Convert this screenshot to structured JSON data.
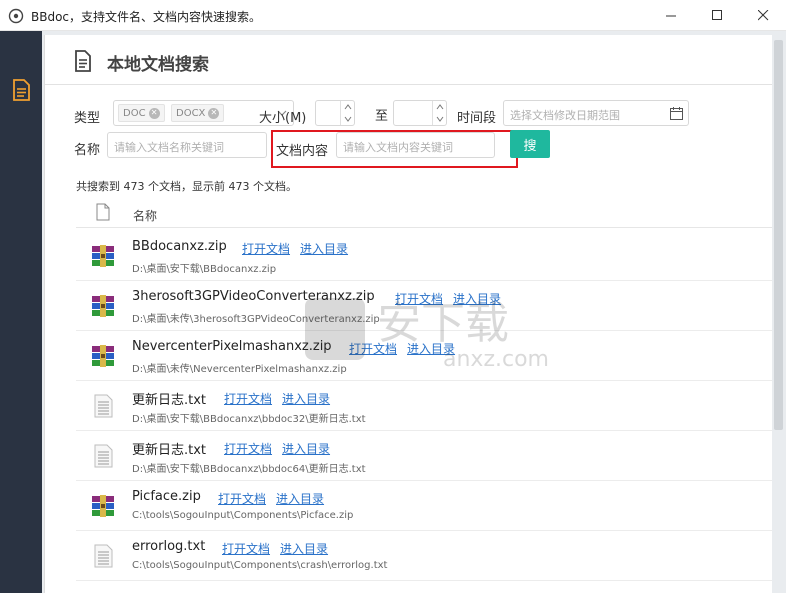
{
  "window": {
    "title": "BBdoc，支持文件名、文档内容快速搜索。"
  },
  "header": {
    "title": "本地文档搜索"
  },
  "filters": {
    "type_label": "类型",
    "types": [
      "DOC",
      "DOCX"
    ],
    "size_label": "大小(M)",
    "size_to_label": "至",
    "time_label": "时间段",
    "time_placeholder": "选择文档修改日期范围",
    "name_label": "名称",
    "name_placeholder": "请输入文档名称关键词",
    "content_label": "文档内容",
    "content_placeholder": "请输入文档内容关键词",
    "search_button": "搜"
  },
  "result_summary": "共搜索到 473 个文档，显示前 473 个文档。",
  "list": {
    "column_name": "名称",
    "open_label": "打开文档",
    "dir_label": "进入目录",
    "items": [
      {
        "name": "BBdocanxz.zip",
        "path": "D:\\桌面\\安下载\\BBdocanxz.zip",
        "icon": "archive-icon"
      },
      {
        "name": "3herosoft3GPVideoConverteranxz.zip",
        "path": "D:\\桌面\\未传\\3herosoft3GPVideoConverteranxz.zip",
        "icon": "archive-icon"
      },
      {
        "name": "NevercenterPixelmashanxz.zip",
        "path": "D:\\桌面\\未传\\NevercenterPixelmashanxz.zip",
        "icon": "archive-icon"
      },
      {
        "name": "更新日志.txt",
        "path": "D:\\桌面\\安下载\\BBdocanxz\\bbdoc32\\更新日志.txt",
        "icon": "text-file-icon"
      },
      {
        "name": "更新日志.txt",
        "path": "D:\\桌面\\安下载\\BBdocanxz\\bbdoc64\\更新日志.txt",
        "icon": "text-file-icon"
      },
      {
        "name": "Picface.zip",
        "path": "C:\\tools\\SogouInput\\Components\\Picface.zip",
        "icon": "archive-icon"
      },
      {
        "name": "errorlog.txt",
        "path": "C:\\tools\\SogouInput\\Components\\crash\\errorlog.txt",
        "icon": "text-file-icon"
      }
    ]
  },
  "watermark": {
    "text": "安下载",
    "sub": "anxz.com"
  },
  "colors": {
    "sidebar": "#2a3342",
    "accent": "#1fb89e",
    "link": "#2a72c9",
    "highlight": "#e0181f",
    "sidebar_icon": "#f0a030"
  }
}
